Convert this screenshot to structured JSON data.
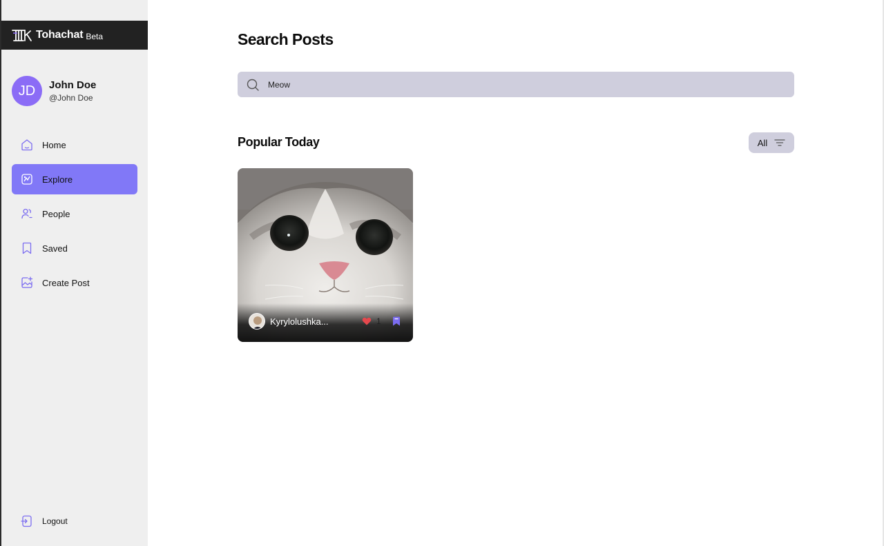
{
  "brand": {
    "name": "Tohachat",
    "badge": "Beta"
  },
  "profile": {
    "initials": "JD",
    "name": "John Doe",
    "handle": "@John Doe"
  },
  "nav": {
    "items": [
      {
        "label": "Home",
        "icon": "home-icon",
        "active": false
      },
      {
        "label": "Explore",
        "icon": "explore-icon",
        "active": true
      },
      {
        "label": "People",
        "icon": "people-icon",
        "active": false
      },
      {
        "label": "Saved",
        "icon": "bookmark-icon",
        "active": false
      },
      {
        "label": "Create Post",
        "icon": "create-post-icon",
        "active": false
      }
    ],
    "logout": "Logout"
  },
  "main": {
    "title": "Search Posts",
    "search": {
      "value": "Meow",
      "icon": "search-icon"
    },
    "section_title": "Popular Today",
    "filter": {
      "label": "All",
      "icon": "filter-icon"
    },
    "posts": [
      {
        "username": "Kyrylolushka...",
        "likes": "1",
        "liked": true,
        "saved": true
      }
    ]
  },
  "colors": {
    "accent": "#8178f7",
    "avatar": "#8b6cf6",
    "brand_bar": "#222222",
    "sidebar_bg": "#efefef",
    "input_bg": "#cfcedd",
    "like": "#e5484d",
    "save": "#7b6cf0"
  }
}
